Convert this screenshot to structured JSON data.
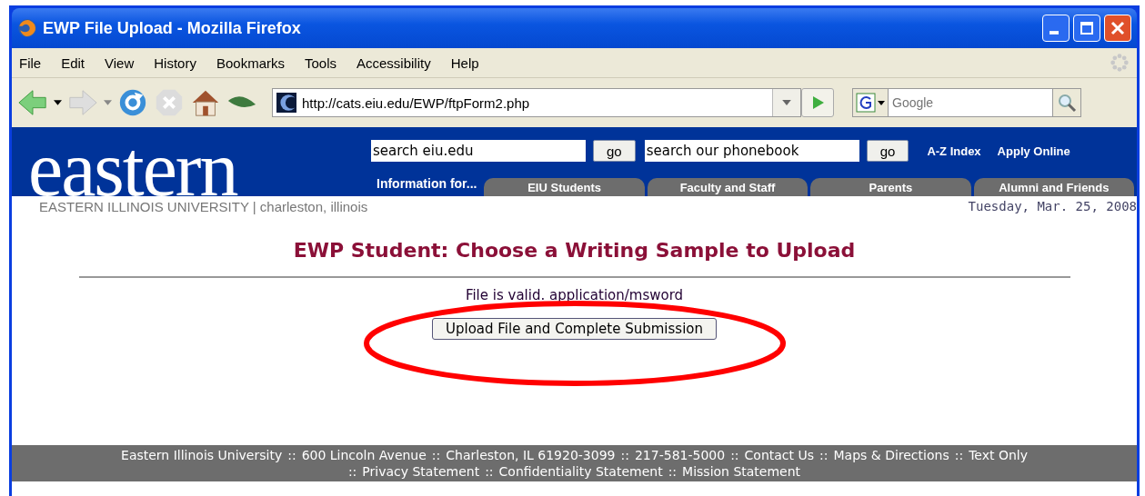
{
  "window": {
    "title": "EWP File Upload - Mozilla Firefox"
  },
  "menu": [
    "File",
    "Edit",
    "View",
    "History",
    "Bookmarks",
    "Tools",
    "Accessibility",
    "Help"
  ],
  "toolbar": {
    "back_disabled": false,
    "forward_disabled": true,
    "stop_disabled": true,
    "url": "http://cats.eiu.edu/EWP/ftpForm2.php",
    "search_placeholder": "Google"
  },
  "site": {
    "logo": "eastern",
    "search1": "search eiu.edu",
    "go1": "go",
    "search2": "search our phonebook",
    "go2": "go",
    "links": [
      "A-Z Index",
      "Apply Online"
    ],
    "info_label": "Information for...",
    "tabs": [
      "EIU Students",
      "Faculty and Staff",
      "Parents",
      "Alumni and Friends"
    ],
    "tagline": "EASTERN ILLINOIS UNIVERSITY | charleston, illinois",
    "date": "Tuesday, Mar. 25, 2008"
  },
  "heading": "EWP Student: Choose a Writing Sample to Upload",
  "message": "File is valid. application/msword",
  "submit": "Upload File and Complete Submission",
  "annotation": {
    "kind": "ellipse",
    "color": "#ff0000"
  },
  "footer": [
    [
      "Eastern Illinois University",
      "::",
      "600 Lincoln Avenue",
      "::",
      "Charleston, IL 61920-3099",
      "::",
      "217-581-5000",
      "::",
      "Contact Us",
      "::",
      "Maps & Directions",
      "::",
      "Text Only"
    ],
    [
      "::",
      "Privacy Statement",
      "::",
      "Confidentiality Statement",
      "::",
      "Mission Statement"
    ]
  ]
}
